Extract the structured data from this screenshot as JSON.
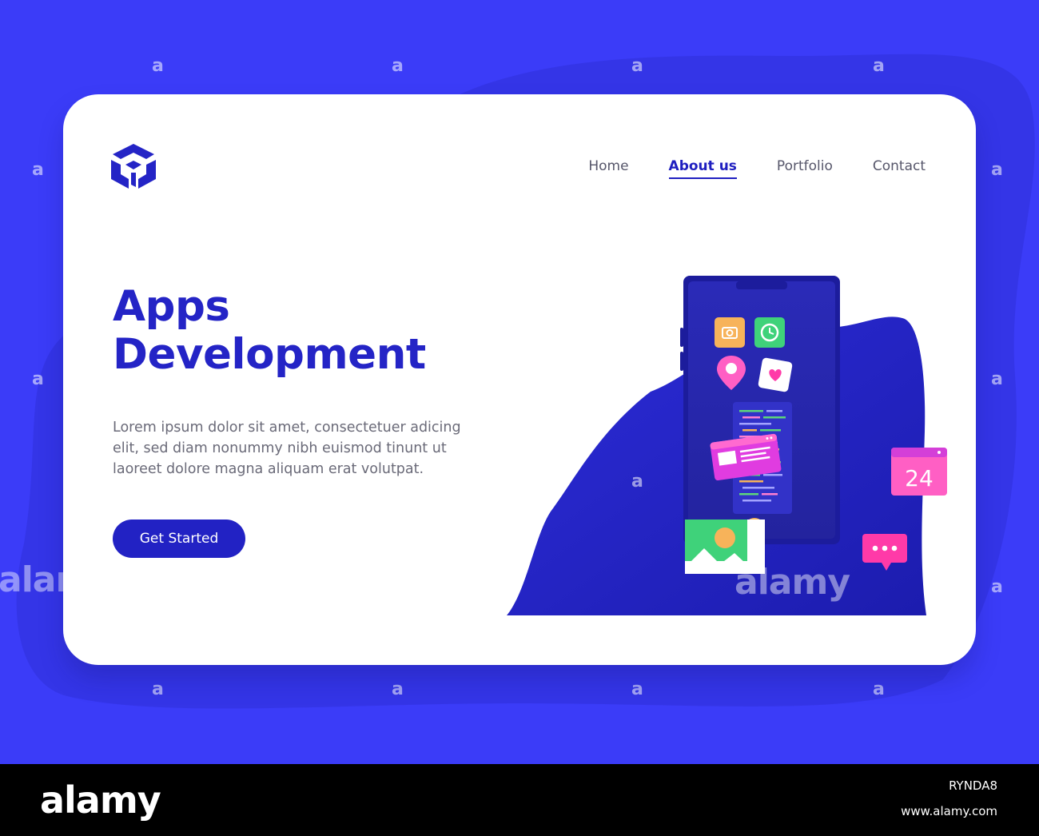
{
  "brand": {
    "logo_icon": "cube-logo-icon",
    "accent": "#2424c6",
    "background": "#3b3cf8"
  },
  "nav": {
    "items": [
      {
        "label": "Home"
      },
      {
        "label": "About us"
      },
      {
        "label": "Portfolio"
      },
      {
        "label": "Contact"
      }
    ],
    "active": "About us"
  },
  "hero": {
    "title_line1": "Apps",
    "title_line2": "Development",
    "body": "Lorem ipsum dolor sit amet, consectetuer adicing elit, sed diam nonummy nibh euismod tinunt ut laoreet dolore magna aliquam erat volutpat.",
    "cta_label": "Get Started"
  },
  "illustration": {
    "calendar_number": "24",
    "icons": [
      "camera-icon",
      "clock-icon",
      "map-pin-icon",
      "heart-icon",
      "code-icon",
      "chat-bubble-icon",
      "image-icon",
      "browser-window-icon",
      "calendar-icon"
    ]
  },
  "watermark": {
    "glyph": "a",
    "word": "alamy"
  },
  "footer": {
    "logo": "alamy",
    "image_id": "RYNDA8",
    "url": "www.alamy.com"
  }
}
